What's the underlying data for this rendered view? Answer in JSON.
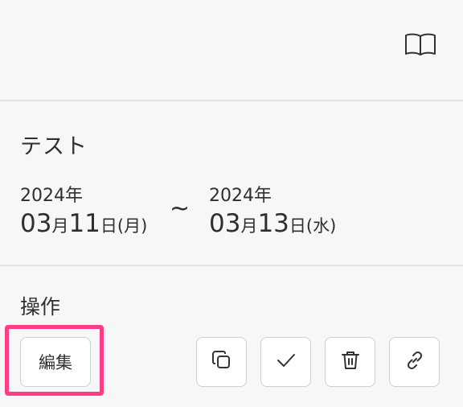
{
  "header": {
    "book_icon": "book-open-icon"
  },
  "event": {
    "title": "テスト",
    "start": {
      "year": "2024年",
      "month": "03",
      "month_unit": "月",
      "day": "11",
      "day_unit": "日",
      "weekday": "(月)"
    },
    "separator": "~",
    "end": {
      "year": "2024年",
      "month": "03",
      "month_unit": "月",
      "day": "13",
      "day_unit": "日",
      "weekday": "(水)"
    }
  },
  "operations": {
    "label": "操作",
    "edit_label": "編集",
    "icons": [
      "copy-icon",
      "check-icon",
      "trash-icon",
      "link-icon"
    ]
  },
  "colors": {
    "background": "#f7f7f8",
    "divider": "#e2e2e4",
    "button_border": "#cfd0d4",
    "highlight": "#ff3d86"
  }
}
